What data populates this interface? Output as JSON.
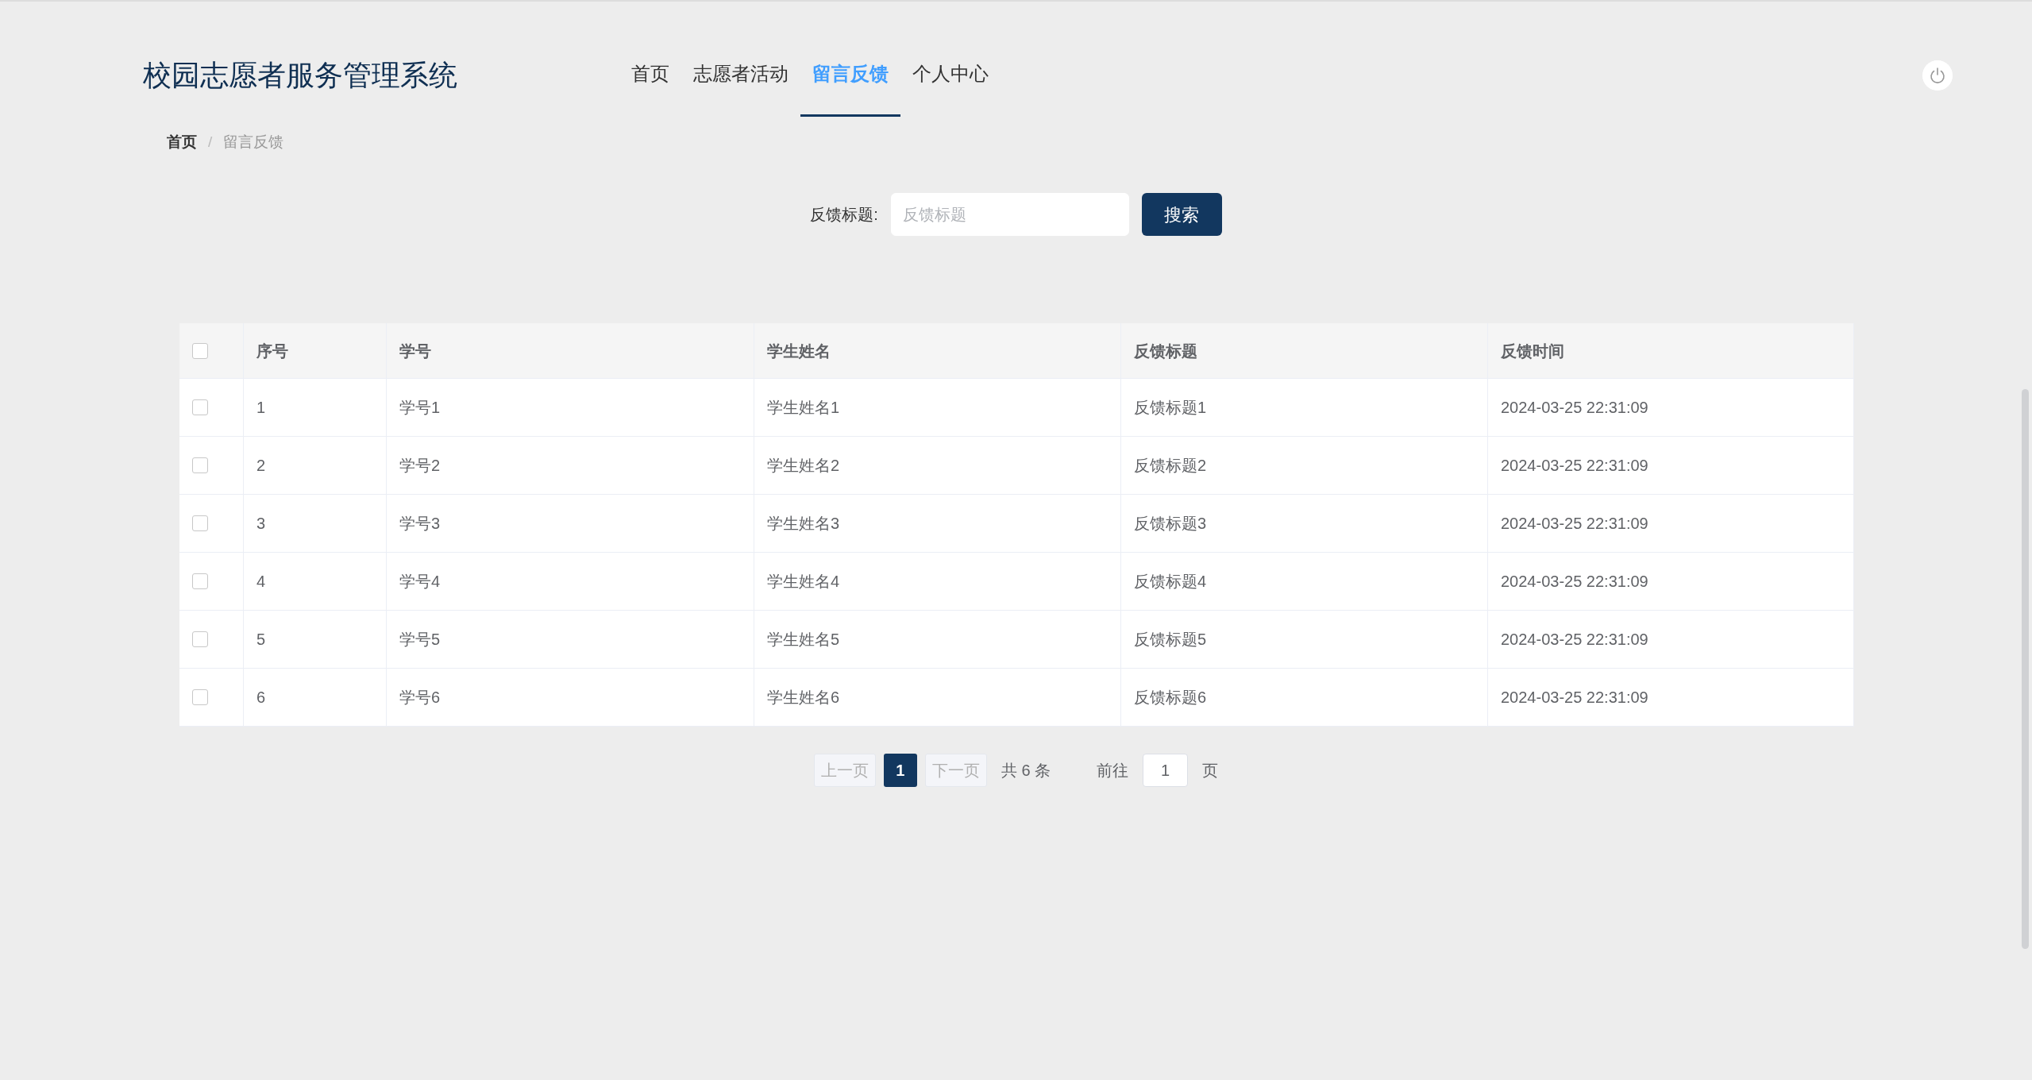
{
  "header": {
    "title": "校园志愿者服务管理系统",
    "nav": [
      {
        "label": "首页",
        "selected": false
      },
      {
        "label": "志愿者活动",
        "selected": false
      },
      {
        "label": "留言反馈",
        "selected": true
      },
      {
        "label": "个人中心",
        "selected": false
      }
    ]
  },
  "breadcrumb": [
    "首页",
    "留言反馈"
  ],
  "breadcrumb_separator": "/",
  "search": {
    "label": "反馈标题:",
    "placeholder": "反馈标题",
    "button": "搜索"
  },
  "table": {
    "columns": [
      "序号",
      "学号",
      "学生姓名",
      "反馈标题",
      "反馈时间"
    ],
    "header_checked": false,
    "rows": [
      {
        "checked": false,
        "cells": [
          "1",
          "学号1",
          "学生姓名1",
          "反馈标题1",
          "2024-03-25 22:31:09"
        ]
      },
      {
        "checked": false,
        "cells": [
          "2",
          "学号2",
          "学生姓名2",
          "反馈标题2",
          "2024-03-25 22:31:09"
        ]
      },
      {
        "checked": false,
        "cells": [
          "3",
          "学号3",
          "学生姓名3",
          "反馈标题3",
          "2024-03-25 22:31:09"
        ]
      },
      {
        "checked": false,
        "cells": [
          "4",
          "学号4",
          "学生姓名4",
          "反馈标题4",
          "2024-03-25 22:31:09"
        ]
      },
      {
        "checked": false,
        "cells": [
          "5",
          "学号5",
          "学生姓名5",
          "反馈标题5",
          "2024-03-25 22:31:09"
        ]
      },
      {
        "checked": false,
        "cells": [
          "6",
          "学号6",
          "学生姓名6",
          "反馈标题6",
          "2024-03-25 22:31:09"
        ]
      }
    ]
  },
  "pagination": {
    "prev": "上一页",
    "pages": [
      {
        "label": "1",
        "selected": true
      }
    ],
    "next": "下一页",
    "total": "共 6 条",
    "goto": "前往",
    "goto_value": "1",
    "suffix": "页"
  }
}
